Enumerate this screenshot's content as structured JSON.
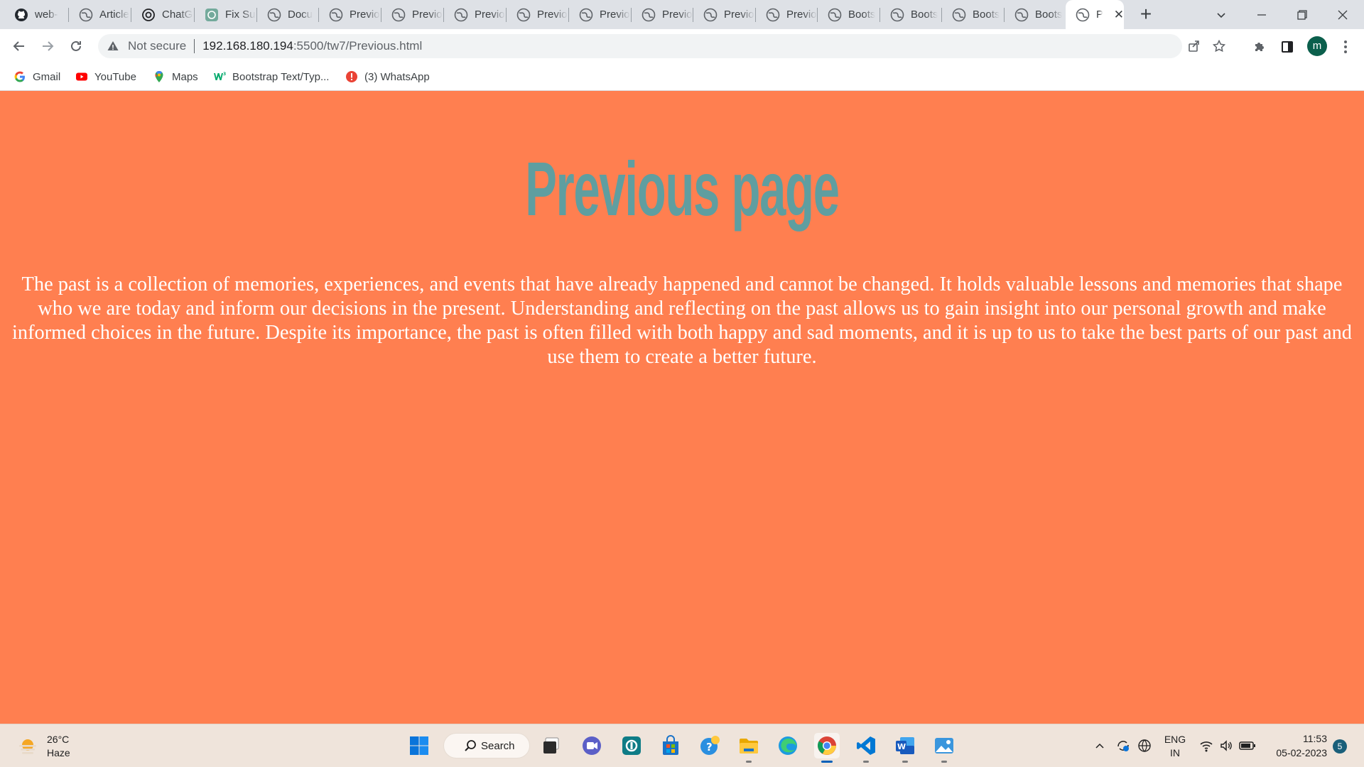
{
  "browser": {
    "tabs": [
      {
        "title": "web-",
        "icon": "github-icon"
      },
      {
        "title": "Article",
        "icon": "globe-icon"
      },
      {
        "title": "ChatGPT",
        "icon": "openai-icon"
      },
      {
        "title": "Fix Su",
        "icon": "openai-green-icon"
      },
      {
        "title": "Docu",
        "icon": "globe-icon"
      },
      {
        "title": "Previo",
        "icon": "globe-icon"
      },
      {
        "title": "Previo",
        "icon": "globe-icon"
      },
      {
        "title": "Previo",
        "icon": "globe-icon"
      },
      {
        "title": "Previo",
        "icon": "globe-icon"
      },
      {
        "title": "Previo",
        "icon": "globe-icon"
      },
      {
        "title": "Previo",
        "icon": "globe-icon"
      },
      {
        "title": "Previo",
        "icon": "globe-icon"
      },
      {
        "title": "Previo",
        "icon": "globe-icon"
      },
      {
        "title": "Boots",
        "icon": "globe-icon"
      },
      {
        "title": "Boots",
        "icon": "globe-icon"
      },
      {
        "title": "Boots",
        "icon": "globe-icon"
      },
      {
        "title": "Boots",
        "icon": "globe-icon"
      }
    ],
    "active_tab": {
      "title": "Pr",
      "close_glyph": "✕"
    },
    "new_tab_glyph": "+",
    "address": {
      "security_label": "Not secure",
      "host": "192.168.180.194",
      "path": ":5500/tw7/Previous.html"
    },
    "profile_initial": "m",
    "bookmarks": [
      {
        "label": "Gmail",
        "icon": "google-icon"
      },
      {
        "label": "YouTube",
        "icon": "youtube-icon"
      },
      {
        "label": "Maps",
        "icon": "maps-pin-icon"
      },
      {
        "label": "Bootstrap Text/Typ...",
        "icon": "w3schools-icon"
      },
      {
        "label": "(3) WhatsApp",
        "icon": "whatsapp-alert-icon"
      }
    ]
  },
  "page": {
    "heading": "Previous page",
    "paragraph": "The past is a collection of memories, experiences, and events that have already happened and cannot be changed. It holds valuable lessons and memories that shape who we are today and inform our decisions in the present. Understanding and reflecting on the past allows us to gain insight into our personal growth and make informed choices in the future. Despite its importance, the past is often filled with both happy and sad moments, and it is up to us to take the best parts of our past and use them to create a better future.",
    "colors": {
      "background": "#ff7f50",
      "heading": "#5f9ea0",
      "text": "#ffffff"
    }
  },
  "taskbar": {
    "weather": {
      "temp": "26°C",
      "condition": "Haze"
    },
    "search_label": "Search",
    "language": {
      "line1": "ENG",
      "line2": "IN"
    },
    "clock": {
      "time": "11:53",
      "date": "05-02-2023"
    },
    "notification_count": "5"
  }
}
